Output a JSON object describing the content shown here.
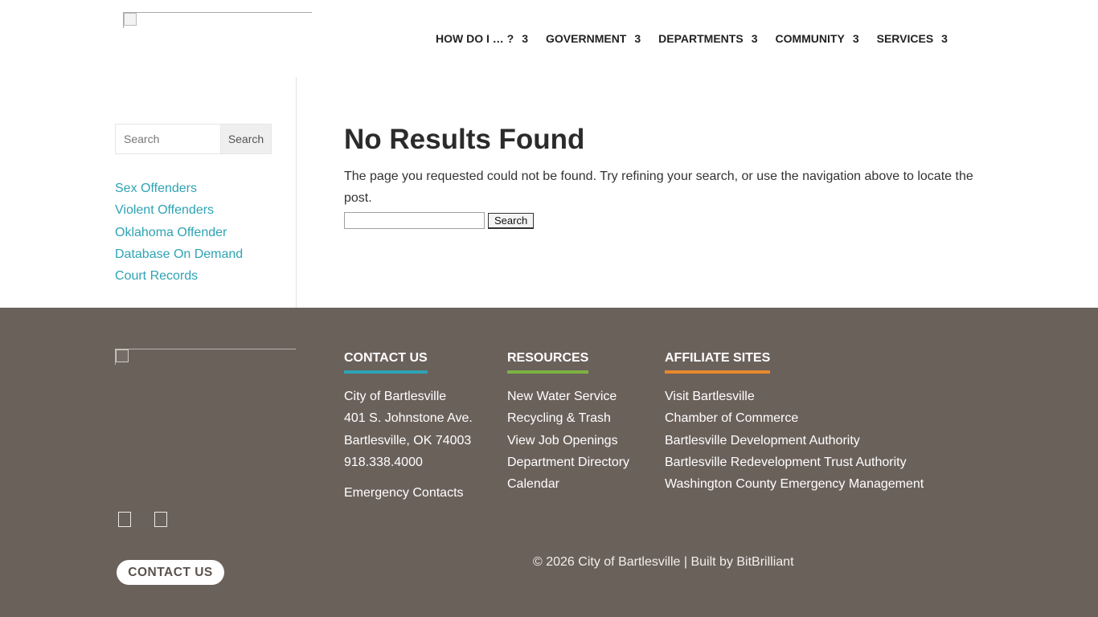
{
  "header": {
    "nav": [
      {
        "label": "HOW DO I … ?",
        "arrow": "3"
      },
      {
        "label": "GOVERNMENT",
        "arrow": "3"
      },
      {
        "label": "DEPARTMENTS",
        "arrow": "3"
      },
      {
        "label": "COMMUNITY",
        "arrow": "3"
      },
      {
        "label": "SERVICES",
        "arrow": "3"
      }
    ]
  },
  "sidebar": {
    "search_placeholder": "Search",
    "search_button": "Search",
    "links": [
      "Sex Offenders",
      "Violent Offenders",
      "Oklahoma Offender",
      "Database On Demand",
      "Court Records"
    ]
  },
  "main": {
    "title": "No Results Found",
    "message": "The page you requested could not be found. Try refining your search, or use the navigation above to locate the post.",
    "search_value": "",
    "search_button": "Search"
  },
  "footer": {
    "contact": {
      "heading": "CONTACT US",
      "accent": "#2ea3b4",
      "lines": [
        "City of Bartlesville",
        "401 S. Johnstone Ave.",
        "Bartlesville, OK 74003",
        "918.338.4000"
      ],
      "extra": "Emergency Contacts"
    },
    "resources": {
      "heading": "RESOURCES",
      "accent": "#7cb342",
      "links": [
        "New Water Service",
        "Recycling & Trash",
        "View Job Openings",
        "Department Directory",
        "Calendar"
      ]
    },
    "affiliates": {
      "heading": "AFFILIATE SITES",
      "accent": "#e8892b",
      "links": [
        "Visit Bartlesville",
        "Chamber of Commerce",
        "Bartlesville Development Authority",
        "Bartlesville Redevelopment Trust Authority",
        "Washington County Emergency Management"
      ]
    },
    "contact_button": "CONTACT US",
    "copyright": "© 2026 City of Bartlesville | Built by BitBrilliant",
    "background": "#6b615b"
  }
}
